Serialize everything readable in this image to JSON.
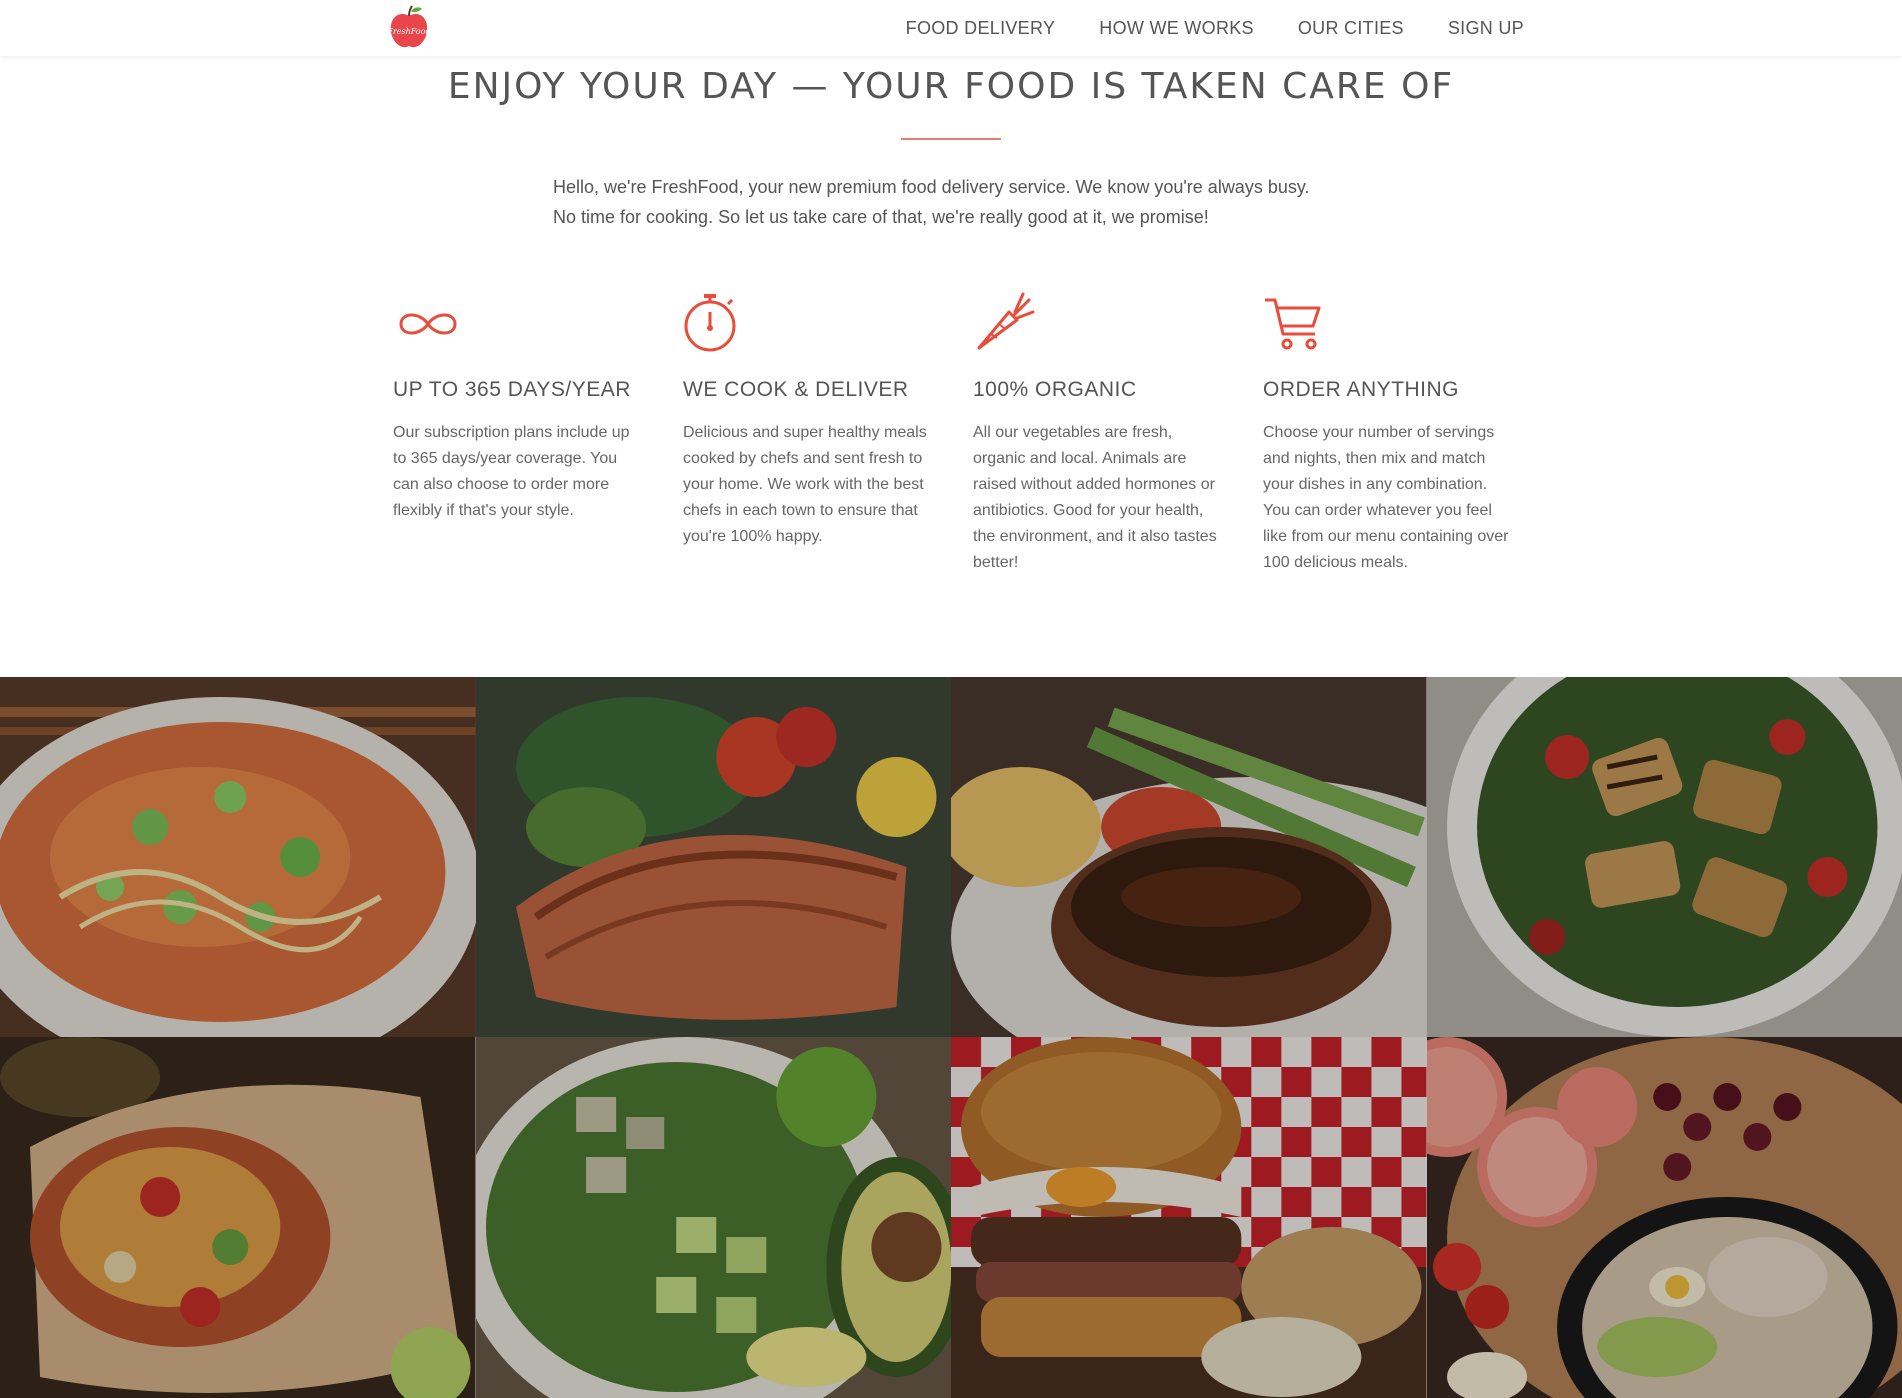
{
  "brand": {
    "name": "FreshFood",
    "logo_text": "FreshFood",
    "accent_color": "#e74c3c"
  },
  "nav": {
    "items": [
      {
        "label": "FOOD DELIVERY"
      },
      {
        "label": "HOW WE WORKS"
      },
      {
        "label": "OUR CITIES"
      },
      {
        "label": "SIGN UP"
      }
    ]
  },
  "hero": {
    "title": "ENJOY YOUR DAY — YOUR FOOD IS TAKEN CARE OF",
    "intro_line1": "Hello, we're FreshFood, your new premium food delivery service. We know you're always busy.",
    "intro_line2": "No time for cooking. So let us take care of that, we're really good at it, we promise!"
  },
  "features": [
    {
      "icon": "infinity-icon",
      "title": "UP TO 365 DAYS/YEAR",
      "text": "Our subscription plans include up to 365 days/year coverage. You can also choose to order more flexibly if that's your style."
    },
    {
      "icon": "stopwatch-icon",
      "title": "WE COOK & DELIVER",
      "text": "Delicious and super healthy meals cooked by chefs and sent fresh to your home. We work with the best chefs in each town to ensure that you're 100% happy."
    },
    {
      "icon": "carrot-icon",
      "title": "100% ORGANIC",
      "text": "All our vegetables are fresh, organic and local. Animals are raised without added hormones or antibiotics. Good for your health, the environment, and it also tastes better!"
    },
    {
      "icon": "cart-icon",
      "title": "ORDER ANYTHING",
      "text": "Choose your number of servings and nights, then mix and match your dishes in any combination. You can order whatever you feel like from our menu containing over 100 delicious meals."
    }
  ],
  "gallery": [
    {
      "icon": "rice-bowl-photo"
    },
    {
      "icon": "salmon-photo"
    },
    {
      "icon": "steak-photo"
    },
    {
      "icon": "halloumi-salad-photo"
    },
    {
      "icon": "burrito-photo"
    },
    {
      "icon": "avocado-bowl-photo"
    },
    {
      "icon": "burger-photo"
    },
    {
      "icon": "fruit-board-photo"
    }
  ]
}
